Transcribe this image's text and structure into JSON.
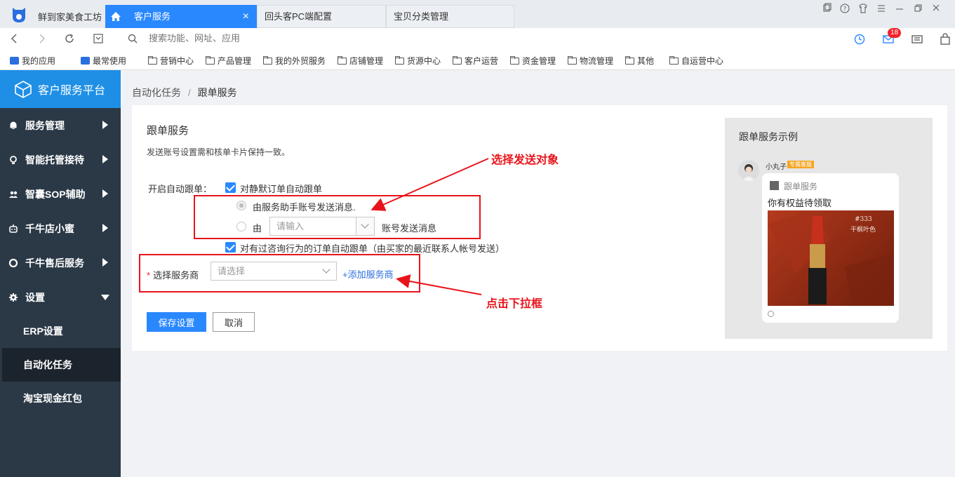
{
  "app": {
    "name": "鲜到家美食工坊",
    "tabs": [
      {
        "label": "客户服务",
        "active": true
      },
      {
        "label": "回头客PC端配置"
      },
      {
        "label": "宝贝分类管理"
      }
    ],
    "tab_close": "×"
  },
  "address": {
    "placeholder": "搜索功能、网址、应用",
    "notification_count": "18"
  },
  "bookmarks": [
    {
      "label": "我的应用",
      "icon": "box-icon"
    },
    {
      "label": "最常使用",
      "icon": "box-icon"
    },
    {
      "label": "营销中心",
      "icon": "folder-icon"
    },
    {
      "label": "产品管理",
      "icon": "folder-icon"
    },
    {
      "label": "我的外贸服务",
      "icon": "folder-icon"
    },
    {
      "label": "店铺管理",
      "icon": "folder-icon"
    },
    {
      "label": "货源中心",
      "icon": "folder-icon"
    },
    {
      "label": "客户运营",
      "icon": "folder-icon"
    },
    {
      "label": "资金管理",
      "icon": "folder-icon"
    },
    {
      "label": "物流管理",
      "icon": "folder-icon"
    },
    {
      "label": "其他",
      "icon": "folder-icon"
    },
    {
      "label": "自运营中心",
      "icon": "folder-icon"
    }
  ],
  "sidebar": {
    "title": "客户服务平台",
    "items": [
      {
        "label": "服务管理",
        "icon": "bell-icon"
      },
      {
        "label": "智能托管接待",
        "icon": "bulb-icon"
      },
      {
        "label": "智囊SOP辅助",
        "icon": "group-icon"
      },
      {
        "label": "千牛店小蜜",
        "icon": "robot-icon"
      },
      {
        "label": "千牛售后服务",
        "icon": "shield-icon"
      },
      {
        "label": "设置",
        "icon": "gear-icon",
        "expanded": true
      }
    ],
    "sub_items": [
      {
        "label": "ERP设置"
      },
      {
        "label": "自动化任务",
        "active": true
      },
      {
        "label": "淘宝现金红包"
      }
    ]
  },
  "breadcrumb": {
    "parent": "自动化任务",
    "separator": "/",
    "current": "跟单服务"
  },
  "form": {
    "title": "跟单服务",
    "description": "发送账号设置需和核单卡片保持一致。",
    "auto_follow_label": "开启自动跟单：",
    "silent_order_label": "对静默订单自动跟单",
    "radio_assistant_label": "由服务助手账号发送消息.",
    "radio_custom_prefix": "由",
    "account_select_placeholder": "请输入",
    "radio_custom_suffix": "账号发送消息",
    "consulted_order_label": "对有过咨询行为的订单自动跟单（由买家的最近联系人帐号发送）",
    "provider_label": "选择服务商",
    "provider_placeholder": "请选择",
    "add_provider_label": "+添加服务商",
    "save_label": "保存设置",
    "cancel_label": "取消"
  },
  "annotations": {
    "select_target": "选择发送对象",
    "click_dropdown": "点击下拉框"
  },
  "preview": {
    "title": "跟单服务示例",
    "sender_name": "小丸子",
    "sender_tag": "专属客服",
    "card_subtitle": "跟单服务",
    "card_headline": "你有权益待领取",
    "image_caption_1": "#333",
    "image_caption_2": "干枫叶色"
  },
  "colors": {
    "primary": "#2a88ff",
    "sidebar_bg": "#2b3947",
    "sidebar_header": "#1f8fe6",
    "annotation": "#e8141b"
  }
}
